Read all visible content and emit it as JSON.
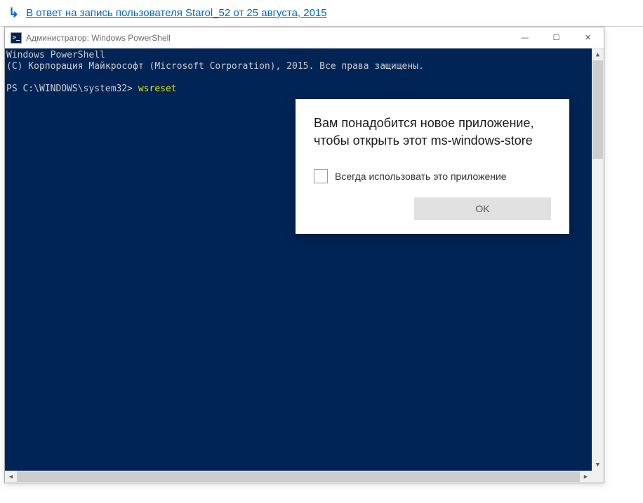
{
  "reply": {
    "arrow": "↳",
    "text": "В ответ на запись пользователя Starol_52 от 25 августа, 2015"
  },
  "window": {
    "icon_text": ">_",
    "title": "Администратор: Windows PowerShell",
    "controls": {
      "minimize": "—",
      "maximize": "☐",
      "close": "✕"
    }
  },
  "terminal": {
    "line1": "Windows PowerShell",
    "line2": "(C) Корпорация Майкрософт (Microsoft Corporation), 2015. Все права защищены.",
    "prompt": "PS C:\\WINDOWS\\system32> ",
    "command": "wsreset"
  },
  "dialog": {
    "title": "Вам понадобится новое приложение, чтобы открыть этот ms-windows-store",
    "checkbox_label": "Всегда использовать это приложение",
    "ok": "OK"
  },
  "scroll": {
    "up": "▲",
    "down": "▼",
    "left": "◀",
    "right": "▶"
  }
}
